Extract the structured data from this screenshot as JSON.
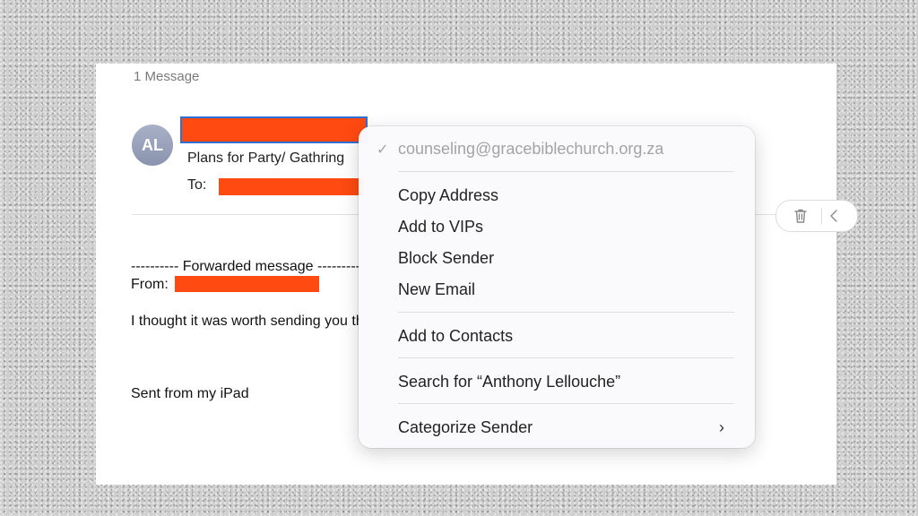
{
  "mail": {
    "message_count": "1 Message",
    "avatar_initials": "AL",
    "subject": "Plans for Party/ Gathring",
    "to_label": "To:",
    "body": {
      "forwarded": "---------- Forwarded message ---------",
      "from_label": "From:",
      "line1": "I thought it was worth sending you this",
      "signature": "Sent from my iPad"
    }
  },
  "toolbar": {
    "trash_icon": "trash-icon",
    "reply_icon": "reply-icon"
  },
  "context_menu": {
    "email": "counseling@gracebiblechurch.org.za",
    "items": {
      "copy": "Copy Address",
      "vip": "Add to VIPs",
      "block": "Block Sender",
      "new_email": "New Email",
      "contacts": "Add to Contacts",
      "search": "Search for “Anthony Lellouche”",
      "categorize": "Categorize Sender"
    },
    "check_glyph": "✓",
    "chevron_glyph": "›"
  },
  "colors": {
    "redaction": "#ff4a12",
    "selection_outline": "#2f6fd6",
    "avatar": "#9aa2bc"
  }
}
